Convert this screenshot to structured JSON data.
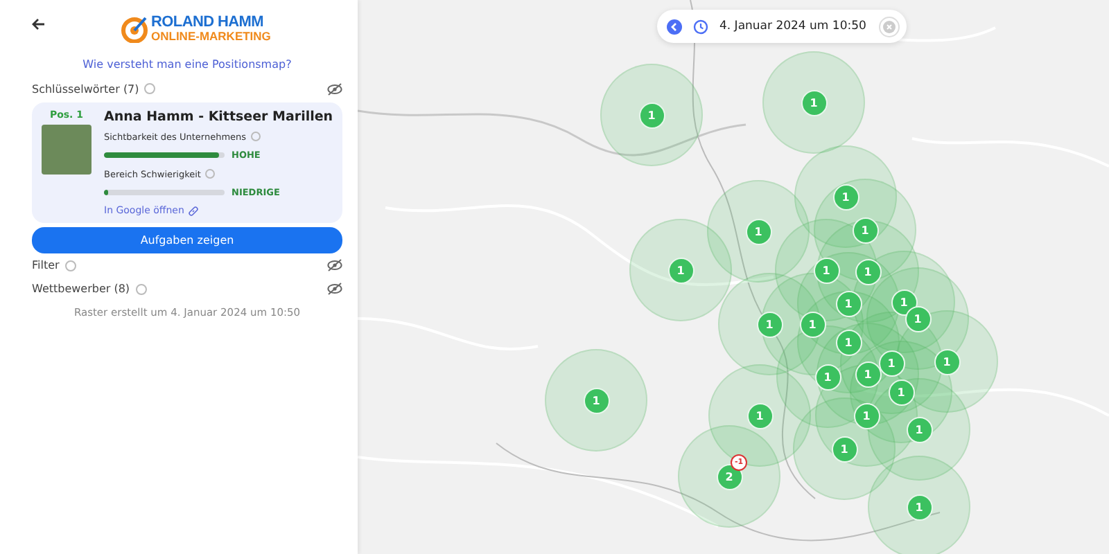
{
  "logo": {
    "line_1": "ROLAND HAMM",
    "line_2": "ONLINE-MARKETING"
  },
  "help_link": "Wie versteht man eine Positionsmap?",
  "keywords": {
    "label": "Schlüsselwörter (7)",
    "visible": false
  },
  "result_card": {
    "position": "Pos. 1",
    "title": "Anna Hamm - Kittseer Marillen",
    "metrics": [
      {
        "label": "Sichtbarkeit des Unternehmens",
        "level": 0.95,
        "rating": "HOHE"
      },
      {
        "label": "Bereich Schwierigkeit",
        "level": 0.03,
        "rating": "NIEDRIGE"
      }
    ],
    "link": "In Google öffnen"
  },
  "tasks_button": "Aufgaben zeigen",
  "sections": [
    {
      "label": "Filter",
      "visible": false
    },
    {
      "label": "Wettbewerber (8)",
      "visible": false
    }
  ],
  "raster_note": "Raster erstellt um 4. Januar 2024 um 10:50",
  "date_pill": {
    "text": "4. Januar 2024 um 10:50"
  },
  "markers": [
    {
      "label": "1"
    },
    {
      "label": "1"
    },
    {
      "label": "1"
    },
    {
      "label": "1"
    },
    {
      "label": "1"
    },
    {
      "label": "1"
    },
    {
      "label": "1"
    },
    {
      "label": "1"
    },
    {
      "label": "1"
    },
    {
      "label": "1"
    },
    {
      "label": "1"
    },
    {
      "label": "1"
    },
    {
      "label": "1"
    },
    {
      "label": "1"
    },
    {
      "label": "1"
    },
    {
      "label": "1"
    },
    {
      "label": "1"
    },
    {
      "label": "1"
    },
    {
      "label": "1"
    },
    {
      "label": "1"
    },
    {
      "label": "1"
    },
    {
      "label": "1"
    },
    {
      "label": "1"
    },
    {
      "label": "1"
    },
    {
      "label": "2",
      "change": "-1"
    },
    {
      "label": "1"
    }
  ]
}
